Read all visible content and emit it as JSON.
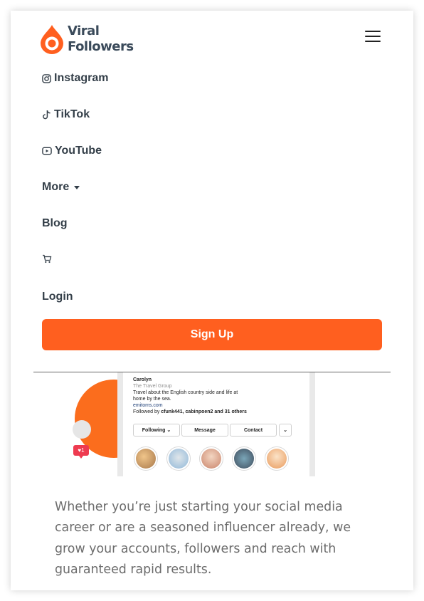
{
  "brand": {
    "line1": "Viral",
    "line2": "Followers",
    "color": "#ff5f1f"
  },
  "header": {
    "menu_icon": "hamburger-menu-icon"
  },
  "nav": {
    "instagram": {
      "label": "Instagram",
      "icon": "instagram-icon"
    },
    "tiktok": {
      "label": "TikTok",
      "icon": "tiktok-icon"
    },
    "youtube": {
      "label": "YouTube",
      "icon": "youtube-icon"
    },
    "more": {
      "label": "More",
      "icon": "caret-down-icon"
    },
    "blog": {
      "label": "Blog"
    },
    "cart": {
      "icon": "cart-icon"
    },
    "login": {
      "label": "Login"
    }
  },
  "signup": {
    "label": "Sign Up",
    "color": "#ff5f1f"
  },
  "profile": {
    "name": "Carolyn",
    "category": "The Travel Group",
    "bio_line1": "Travel about the English country side and life at",
    "bio_line2": "home by the sea.",
    "link": "emitoms.com",
    "followed_prefix": "Followed by ",
    "followed_names": "cfunk441, cabinpoen2 and 31 others",
    "buttons": {
      "following": "Following ⌄",
      "message": "Message",
      "contact": "Contact",
      "more": "⌄"
    },
    "notification_count": "1"
  },
  "intro": "Whether you’re just starting your social media career or are a seasoned influencer already, we grow your accounts, followers and reach with guaranteed rapid results."
}
